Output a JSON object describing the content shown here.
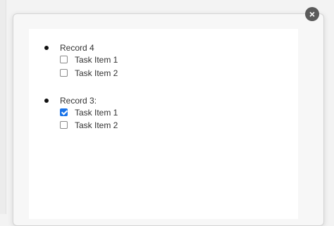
{
  "modal": {
    "close_glyph": "×",
    "records": [
      {
        "title": "Record 4",
        "tasks": [
          {
            "label": "Task Item 1",
            "checked": false
          },
          {
            "label": "Task Item 2",
            "checked": false
          }
        ]
      },
      {
        "title": "Record 3:",
        "tasks": [
          {
            "label": "Task Item 1",
            "checked": true
          },
          {
            "label": "Task Item 2",
            "checked": false
          }
        ]
      }
    ]
  },
  "colors": {
    "checkbox_checked": "#1a73e8",
    "close_button": "#5b5b5b"
  }
}
